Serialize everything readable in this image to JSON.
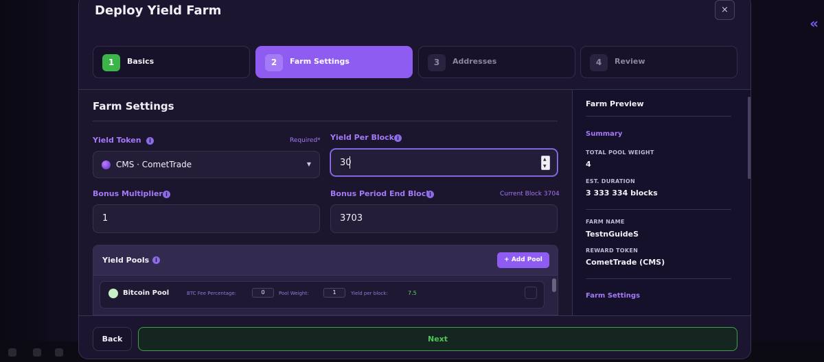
{
  "modal": {
    "title": "Deploy Yield Farm",
    "close_icon": "×"
  },
  "steps": [
    {
      "num": "1",
      "label": "Basics",
      "state": "done"
    },
    {
      "num": "2",
      "label": "Farm Settings",
      "state": "active"
    },
    {
      "num": "3",
      "label": "Addresses",
      "state": "todo"
    },
    {
      "num": "4",
      "label": "Review",
      "state": "todo"
    }
  ],
  "form": {
    "section_title": "Farm Settings",
    "yield_token": {
      "label": "Yield Token",
      "required": "Required*",
      "value": "CMS · CometTrade"
    },
    "yield_per_block": {
      "label": "Yield Per Block",
      "value": "30"
    },
    "bonus_multiplier": {
      "label": "Bonus Multiplier",
      "value": "1"
    },
    "bonus_end_block": {
      "label": "Bonus Period End Block",
      "current_block": "Current Block 3704",
      "value": "3703"
    }
  },
  "pools": {
    "title": "Yield Pools",
    "add_label": "+ Add Pool",
    "rows": [
      {
        "name": "Bitcoin Pool",
        "fee_label": "BTC Fee Percentage:",
        "fee_value": "0",
        "weight_label": "Pool Weight:",
        "weight_value": "1",
        "yield_label": "Yield per block:",
        "yield_value": "7.5"
      }
    ]
  },
  "preview": {
    "title": "Farm Preview",
    "summary_title": "Summary",
    "total_weight_key": "TOTAL POOL WEIGHT",
    "total_weight_val": "4",
    "duration_key": "EST. DURATION",
    "duration_val": "3 333 334 blocks",
    "farm_name_key": "FARM NAME",
    "farm_name_val": "TestnGuideS",
    "reward_key": "REWARD TOKEN",
    "reward_val": "CometTrade (CMS)",
    "settings_title": "Farm Settings"
  },
  "footer": {
    "back_label": "Back",
    "next_label": "Next"
  },
  "icons": {
    "info": "i",
    "chevron": "▼",
    "collapse": "«"
  },
  "colors": {
    "accent": "#8e5cf0",
    "success": "#3bb54a",
    "background": "#1d1630"
  }
}
